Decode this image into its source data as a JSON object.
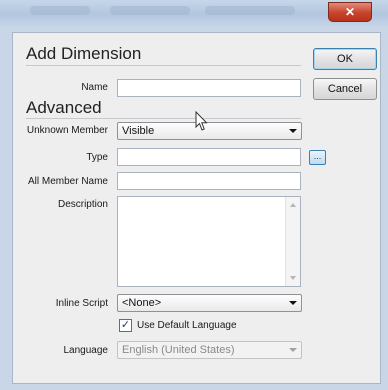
{
  "dialog": {
    "close_glyph": "✕",
    "section_title": "Add Dimension",
    "advanced_title": "Advanced"
  },
  "buttons": {
    "ok": "OK",
    "cancel": "Cancel",
    "ellipsis": "..."
  },
  "form": {
    "name": {
      "label": "Name",
      "value": ""
    },
    "unknown_member": {
      "label": "Unknown Member",
      "value": "Visible"
    },
    "type": {
      "label": "Type",
      "value": ""
    },
    "all_member_name": {
      "label": "All Member Name",
      "value": ""
    },
    "description": {
      "label": "Description",
      "value": ""
    },
    "inline_script": {
      "label": "Inline Script",
      "value": "<None>"
    },
    "use_default_language": {
      "label": "Use Default Language",
      "checked": true,
      "check_glyph": "✓"
    },
    "language": {
      "label": "Language",
      "value": "English (United States)",
      "disabled": true
    }
  },
  "colors": {
    "frame": "#c8d6e7",
    "client": "#eeeeee",
    "close": "#c8432b",
    "accent": "#3c7fb1"
  },
  "icons": [
    "close-icon",
    "chevron-down-icon",
    "scroll-up-icon",
    "scroll-down-icon",
    "checkmark-icon",
    "mouse-cursor-icon"
  ]
}
